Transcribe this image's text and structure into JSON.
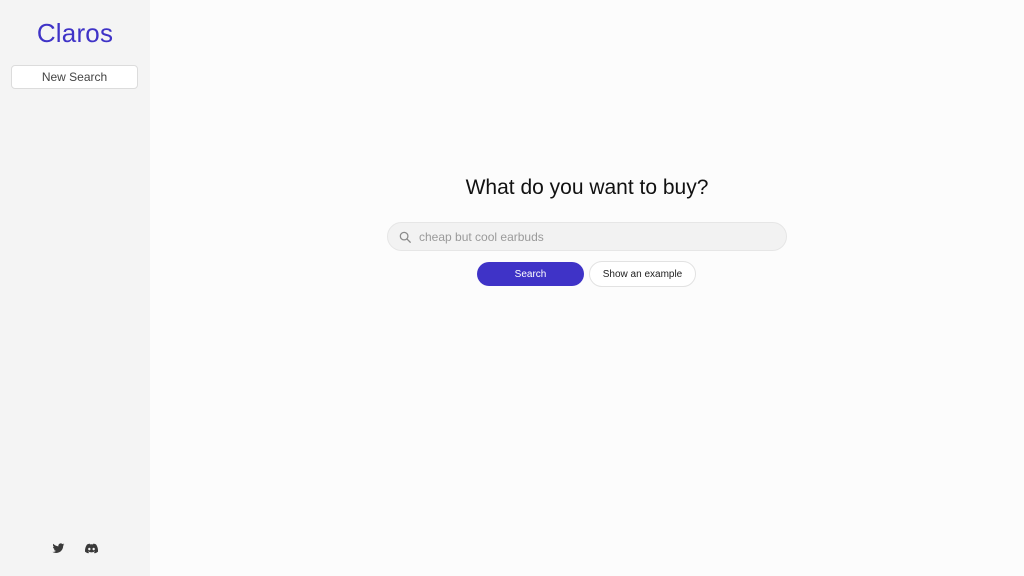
{
  "sidebar": {
    "logo": "Claros",
    "new_search_label": "New Search",
    "social": [
      {
        "icon": "twitter-icon"
      },
      {
        "icon": "discord-icon"
      }
    ]
  },
  "main": {
    "headline": "What do you want to buy?",
    "search": {
      "placeholder": "cheap but cool earbuds",
      "value": "",
      "icon": "search-icon"
    },
    "search_button_label": "Search",
    "example_button_label": "Show an example"
  },
  "colors": {
    "brand": "#3f33c7",
    "sidebar_bg": "#f4f4f4",
    "page_bg": "#fcfcfc"
  }
}
